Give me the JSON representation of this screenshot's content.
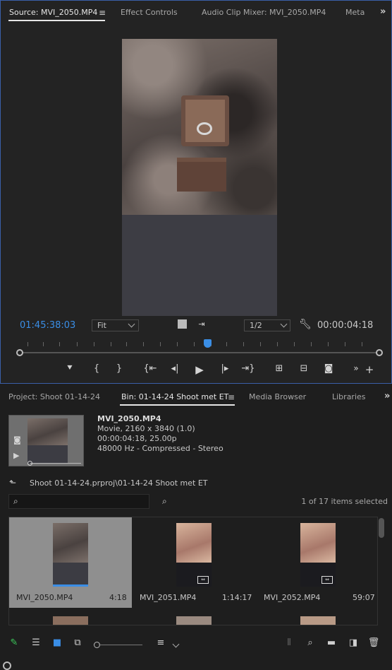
{
  "source_panel": {
    "tabs": [
      {
        "label": "Source: MVI_2050.MP4",
        "active": true
      },
      {
        "label": "Effect Controls",
        "active": false
      },
      {
        "label": "Audio Clip Mixer: MVI_2050.MP4",
        "active": false
      },
      {
        "label": "Meta",
        "active": false
      }
    ],
    "menu_glyph": "≡",
    "overflow_glyph": "»",
    "current_timecode": "01:45:38:03",
    "zoom_select": "Fit",
    "resolution_select": "1/2",
    "duration": "00:00:04:18",
    "timecode_color": "#3a8ee6"
  },
  "project_panel": {
    "tabs": [
      {
        "label": "Project: Shoot 01-14-24",
        "active": false
      },
      {
        "label": "Bin: 01-14-24 Shoot met ET",
        "active": true
      },
      {
        "label": "Media Browser",
        "active": false
      },
      {
        "label": "Libraries",
        "active": false
      }
    ],
    "menu_glyph": "≡",
    "preview": {
      "name": "MVI_2050.MP4",
      "line1": "Movie, 2160 x 3840 (1.0)",
      "line2": "00:00:04:18, 25.00p",
      "line3": "48000 Hz - Compressed - Stereo"
    },
    "path": "Shoot 01-14-24.prproj\\01-14-24 Shoot met ET",
    "search_value": "",
    "selection_count": "1 of 17 items selected",
    "clips": [
      {
        "name": "MVI_2050.MP4",
        "duration": "4:18",
        "selected": true,
        "progress": 1.0
      },
      {
        "name": "MVI_2051.MP4",
        "duration": "1:14:17",
        "selected": false
      },
      {
        "name": "MVI_2052.MP4",
        "duration": "59:07",
        "selected": false
      }
    ]
  }
}
